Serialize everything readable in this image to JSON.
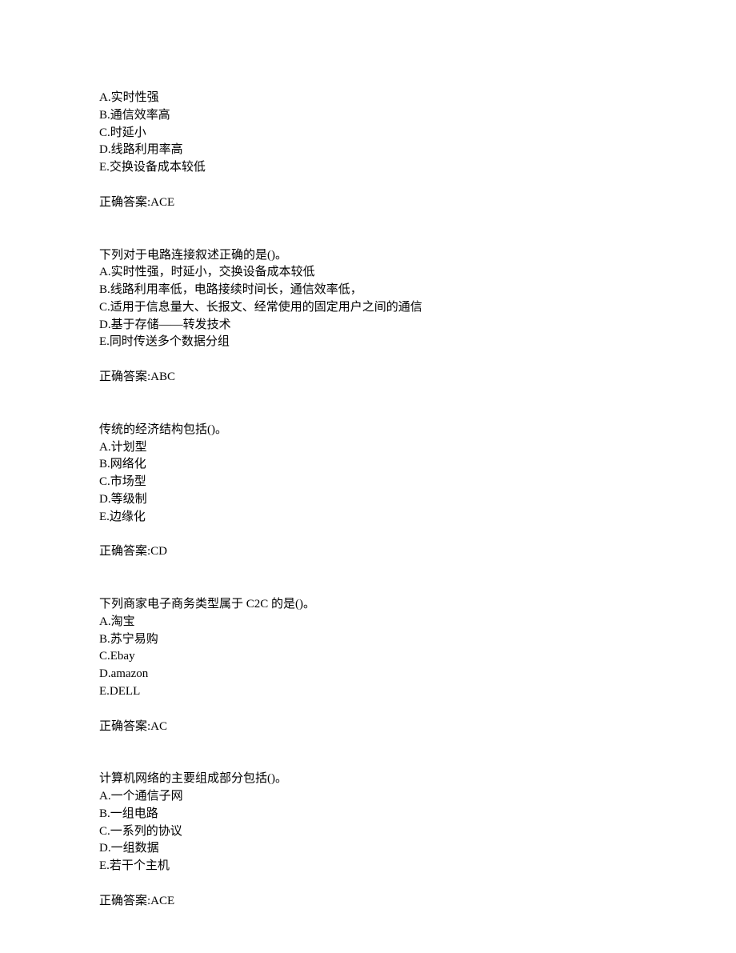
{
  "questions": [
    {
      "stem": "",
      "options": [
        "A.实时性强",
        "B.通信效率高",
        "C.时延小",
        "D.线路利用率高",
        "E.交换设备成本较低"
      ],
      "answer": "正确答案:ACE"
    },
    {
      "stem": "下列对于电路连接叙述正确的是()。",
      "options": [
        "A.实时性强，时延小，交换设备成本较低",
        "B.线路利用率低，电路接续时间长，通信效率低，",
        "C.适用于信息量大、长报文、经常使用的固定用户之间的通信",
        "D.基于存储——转发技术",
        "E.同时传送多个数据分组"
      ],
      "answer": "正确答案:ABC"
    },
    {
      "stem": "传统的经济结构包括()。",
      "options": [
        "A.计划型",
        "B.网络化",
        "C.市场型",
        "D.等级制",
        "E.边缘化"
      ],
      "answer": "正确答案:CD"
    },
    {
      "stem": "下列商家电子商务类型属于 C2C 的是()。",
      "options": [
        "A.淘宝",
        "B.苏宁易购",
        "C.Ebay",
        "D.amazon",
        "E.DELL"
      ],
      "answer": "正确答案:AC"
    },
    {
      "stem": "计算机网络的主要组成部分包括()。",
      "options": [
        "A.一个通信子网",
        "B.一组电路",
        "C.一系列的协议",
        "D.一组数据",
        "E.若干个主机"
      ],
      "answer": "正确答案:ACE"
    }
  ]
}
